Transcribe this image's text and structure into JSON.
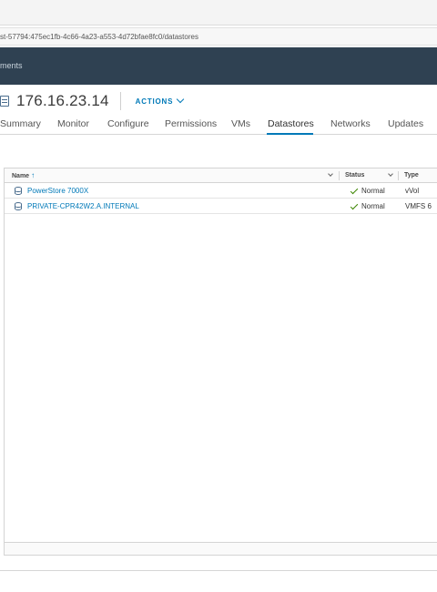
{
  "browser": {
    "url": "st-57794:475ec1fb-4c66-4a23-a553-4d72bfae8fc0/datastores"
  },
  "header": {
    "text": "ments"
  },
  "object": {
    "title": "176.16.23.14",
    "actions_label": "ACTIONS"
  },
  "tabs": [
    {
      "label": "Summary"
    },
    {
      "label": "Monitor"
    },
    {
      "label": "Configure"
    },
    {
      "label": "Permissions"
    },
    {
      "label": "VMs"
    },
    {
      "label": "Datastores",
      "active": true
    },
    {
      "label": "Networks"
    },
    {
      "label": "Updates"
    }
  ],
  "grid": {
    "columns": {
      "name": "Name",
      "status": "Status",
      "type": "Type"
    },
    "rows": [
      {
        "name": "PowerStore 7000X",
        "status": "Normal",
        "type": "vVol"
      },
      {
        "name": "PRIVATE-CPR42W2.A.INTERNAL",
        "status": "Normal",
        "type": "VMFS 6"
      }
    ]
  },
  "colors": {
    "accent": "#0079b8",
    "header_bg": "#2f4152",
    "status_ok": "#3c8500"
  }
}
